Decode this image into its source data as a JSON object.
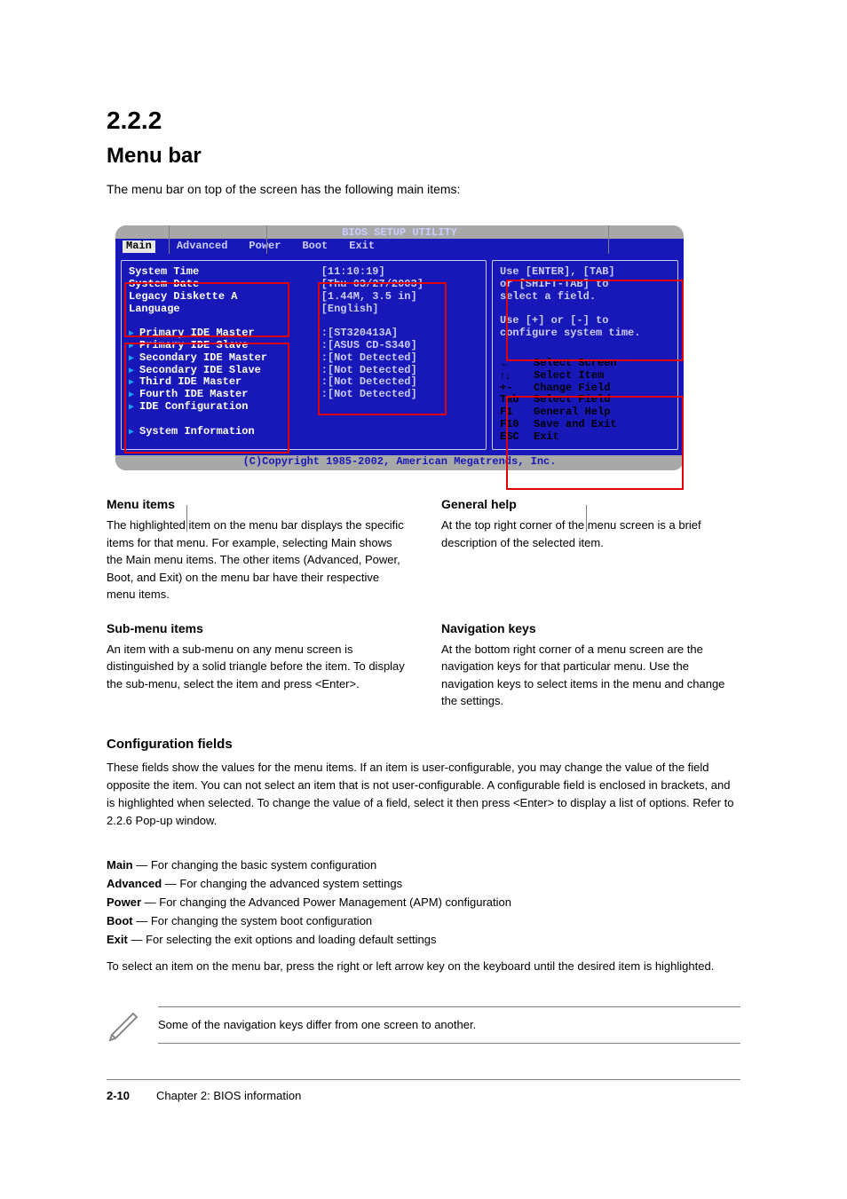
{
  "section": {
    "number": "2.2.2",
    "title": "Menu bar"
  },
  "lead": "The menu bar on top of the screen has the following main items:",
  "bios": {
    "title": "BIOS SETUP UTILITY",
    "tabs": [
      "Main",
      "Advanced",
      "Power",
      "Boot",
      "Exit"
    ],
    "selected_tab": "Main",
    "left_items": [
      {
        "label": "System Time",
        "value": "[11:10:19]",
        "tri": false,
        "hl": true
      },
      {
        "label": "System Date",
        "value": "[Thu 03/27/2003]",
        "tri": false,
        "hl": true
      },
      {
        "label": "Legacy Diskette A",
        "value": "[1.44M, 3.5 in]",
        "tri": false,
        "hl": true
      },
      {
        "label": "Language",
        "value": "[English]",
        "tri": false,
        "hl": true
      },
      {
        "label": "",
        "value": "",
        "tri": false
      },
      {
        "label": "Primary IDE Master",
        "value": ":[ST320413A]",
        "tri": true,
        "hl": false
      },
      {
        "label": "Primary IDE Slave",
        "value": ":[ASUS CD-S340]",
        "tri": true,
        "hl": false
      },
      {
        "label": "Secondary IDE Master",
        "value": ":[Not Detected]",
        "tri": true,
        "hl": false
      },
      {
        "label": "Secondary IDE Slave",
        "value": ":[Not Detected]",
        "tri": true,
        "hl": false
      },
      {
        "label": "Third IDE Master",
        "value": ":[Not Detected]",
        "tri": true,
        "hl": false
      },
      {
        "label": "Fourth IDE Master",
        "value": ":[Not Detected]",
        "tri": true,
        "hl": false
      },
      {
        "label": "IDE Configuration",
        "value": "",
        "tri": true,
        "hl": false
      },
      {
        "label": "",
        "value": "",
        "tri": false
      },
      {
        "label": "System Information",
        "value": "",
        "tri": true,
        "hl": false
      }
    ],
    "help1": "Use [ENTER], [TAB]",
    "help2": "or [SHIFT-TAB] to",
    "help3": "select a field.",
    "help4": "Use [+] or [-] to",
    "help5": "configure system time.",
    "keys": [
      {
        "k": "←",
        "d": "Select Screen"
      },
      {
        "k": "↑↓",
        "d": "Select Item"
      },
      {
        "k": "+-",
        "d": "Change Field"
      },
      {
        "k": "Tab",
        "d": "Select Field"
      },
      {
        "k": "F1",
        "d": "General Help"
      },
      {
        "k": "F10",
        "d": "Save and Exit"
      },
      {
        "k": "ESC",
        "d": "Exit"
      }
    ],
    "copyright": "(C)Copyright 1985-2002, American Megatrends, Inc."
  },
  "callouts": {
    "menu_items": {
      "title": "Menu items",
      "body": "The highlighted item on the menu bar displays the specific items for that menu. For example, selecting Main shows the Main menu items. The other items (Advanced, Power, Boot, and Exit) on the menu bar have their respective menu items."
    },
    "general_help": {
      "title": "General help",
      "body": "At the top right corner of the menu screen is a brief description of the selected item."
    },
    "sub_menu": {
      "title": "Sub-menu items",
      "body": "An item with a sub-menu on any menu screen is distinguished by a solid triangle before the item. To display the sub-menu, select the item and press <Enter>."
    },
    "config_fields": {
      "title": "Configuration fields",
      "body": "These fields show the values for the menu items. If an item is user-configurable, you may change the value of the field opposite the item. You can not select an item that is not user-configurable. A configurable field is enclosed in brackets, and is highlighted when selected. To change the value of a field, select it then press <Enter> to display a list of options. Refer to 2.2.6 Pop-up window."
    },
    "nav_keys": {
      "title": "Navigation keys",
      "body": "At the bottom right corner of a menu screen are the navigation keys for that particular menu. Use the navigation keys to select items in the menu and change the settings."
    }
  },
  "menu_desc": [
    {
      "name": "Main",
      "desc": "For changing the basic system configuration"
    },
    {
      "name": "Advanced",
      "desc": "For changing the advanced system settings"
    },
    {
      "name": "Power",
      "desc": "For changing the Advanced Power Management (APM) configuration"
    },
    {
      "name": "Boot",
      "desc": "For changing the system boot configuration"
    },
    {
      "name": "Exit",
      "desc": "For selecting the exit options and loading default settings"
    }
  ],
  "menu_tail": "To select an item on the menu bar, press the right or left arrow key on the keyboard until the desired item is highlighted.",
  "note": "Some of the navigation keys differ from one screen to another.",
  "footer": {
    "page": "2-10",
    "chapter": "Chapter 2: BIOS information"
  }
}
